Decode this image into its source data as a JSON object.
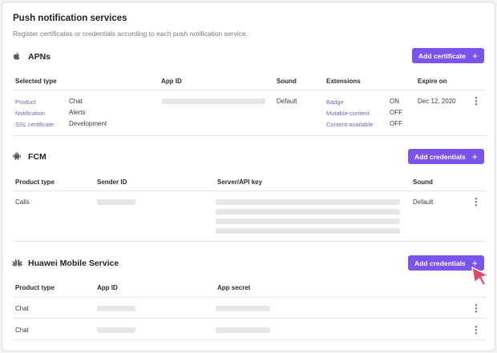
{
  "header": {
    "title": "Push notification services",
    "subtitle": "Register certificates or credentials according to each push notification service."
  },
  "apns": {
    "name": "APNs",
    "icon": "apple-icon",
    "button": "Add certificate",
    "columns": [
      "Selected type",
      "App ID",
      "Sound",
      "Extensions",
      "Expire on"
    ],
    "types": [
      {
        "label": "Product",
        "value": "Chat"
      },
      {
        "label": "Notification",
        "value": "Alerts"
      },
      {
        "label": "SSL certificate",
        "value": "Development"
      }
    ],
    "sound": "Default",
    "extensions": [
      {
        "label": "Badge",
        "value": "ON"
      },
      {
        "label": "Mutable-content",
        "value": "OFF"
      },
      {
        "label": "Content-available",
        "value": "OFF"
      }
    ],
    "expire": "Dec 12, 2020"
  },
  "fcm": {
    "name": "FCM",
    "icon": "android-icon",
    "button": "Add credentials",
    "columns": [
      "Product type",
      "Sender ID",
      "Server/API key",
      "Sound"
    ],
    "row": {
      "product": "Calls",
      "sound": "Default"
    }
  },
  "huawei": {
    "name": "Huawei Mobile Service",
    "icon": "huawei-icon",
    "button": "Add credentials",
    "columns": [
      "Product type",
      "App ID",
      "App secret"
    ],
    "rows": [
      {
        "product": "Chat"
      },
      {
        "product": "Chat"
      }
    ]
  },
  "colors": {
    "accent": "#7b53ef",
    "link": "#6b6bb0",
    "cursor": "#e8456b"
  }
}
